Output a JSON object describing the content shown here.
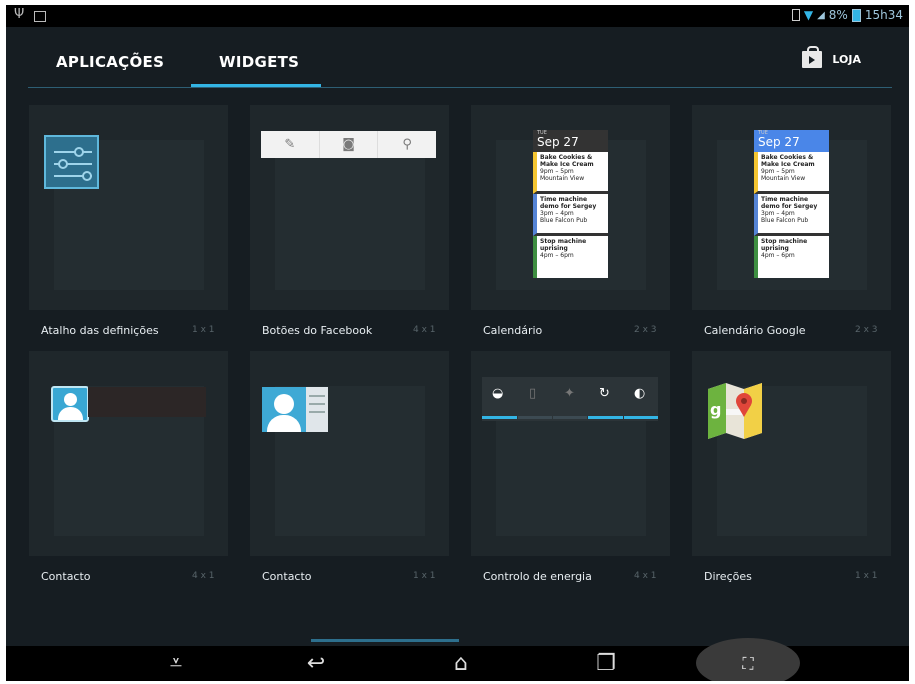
{
  "status": {
    "battery": "8%",
    "time": "15h34"
  },
  "tabs": {
    "apps": "APLICAÇÕES",
    "widgets": "WIDGETS",
    "store": "LOJA"
  },
  "widgets": [
    {
      "label": "Atalho das definições",
      "size": "1 x 1"
    },
    {
      "label": "Botões do Facebook",
      "size": "4 x 1"
    },
    {
      "label": "Calendário",
      "size": "2 x 3"
    },
    {
      "label": "Calendário Google",
      "size": "2 x 3"
    },
    {
      "label": "Contacto",
      "size": "4 x 1"
    },
    {
      "label": "Contacto",
      "size": "1 x 1"
    },
    {
      "label": "Controlo de energia",
      "size": "4 x 1"
    },
    {
      "label": "Direções",
      "size": "1 x 1"
    }
  ],
  "calendar": {
    "dow": "TUE",
    "date": "Sep 27",
    "events": [
      {
        "title": "Bake Cookies & Make Ice Cream",
        "time": "9pm – 5pm",
        "place": "Mountain View"
      },
      {
        "title": "Time machine demo for Sergey",
        "time": "3pm – 4pm",
        "place": "Blue Falcon Pub"
      },
      {
        "title": "Stop machine uprising",
        "time": "4pm – 6pm",
        "place": ""
      }
    ]
  },
  "colors": {
    "accent": "#33b5e5",
    "background": "#161d22",
    "card": "#1f272b"
  }
}
